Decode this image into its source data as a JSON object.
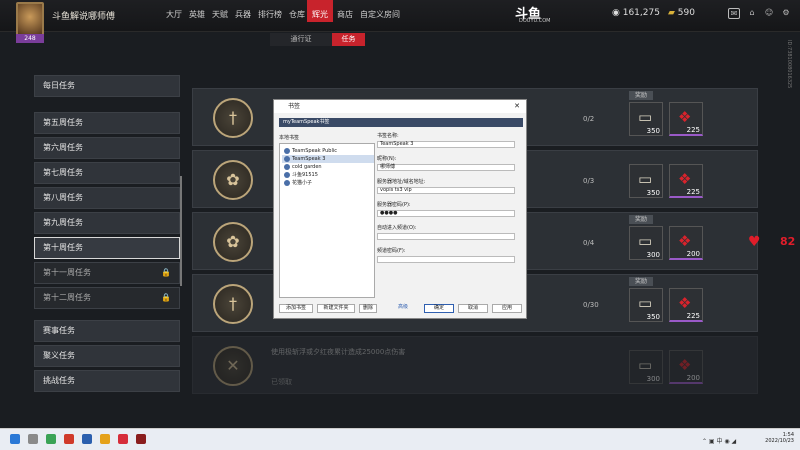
{
  "app": {
    "title": "斗鱼解说哪师傅",
    "level": "248"
  },
  "nav": {
    "items": [
      "大厅",
      "英雄",
      "天赋",
      "兵器",
      "排行榜",
      "仓库",
      "辉光",
      "商店",
      "自定义房间"
    ],
    "active": "辉光"
  },
  "brand": {
    "logo": "斗鱼",
    "sub": "DOUYU.COM"
  },
  "currency": {
    "coins": "161,275",
    "gold": "590"
  },
  "subtabs": {
    "pass": "通行证",
    "task": "任务"
  },
  "sidebar": {
    "items": [
      {
        "label": "每日任务"
      },
      {
        "label": "第五周任务"
      },
      {
        "label": "第六周任务"
      },
      {
        "label": "第七周任务"
      },
      {
        "label": "第八周任务"
      },
      {
        "label": "第九周任务"
      },
      {
        "label": "第十周任务"
      },
      {
        "label": "第十一周任务"
      },
      {
        "label": "第十二周任务"
      },
      {
        "label": "赛事任务"
      },
      {
        "label": "聚义任务"
      },
      {
        "label": "挑战任务"
      }
    ]
  },
  "tasks": [
    {
      "progress": "0/2",
      "scroll": "350",
      "gem": "225",
      "reward": "奖励"
    },
    {
      "progress": "0/3",
      "scroll": "350",
      "gem": "225",
      "reward": "奖励"
    },
    {
      "progress": "0/4",
      "scroll": "300",
      "gem": "200",
      "reward": "奖励"
    },
    {
      "progress": "0/30",
      "scroll": "350",
      "gem": "225",
      "reward": "奖励"
    },
    {
      "text": "使用极斩浮或夕红夜累计造成25000点伤害",
      "sub": "已领取",
      "scroll": "300",
      "gem": "200"
    }
  ],
  "heart": {
    "count": "82"
  },
  "side_id": "ID:7381008016325",
  "dialog": {
    "title": "书签",
    "close": "✕",
    "header": "myTeamSpeak书签",
    "tree_label": "本地书签",
    "tree": [
      "TeamSpeak Public",
      "TeamSpeak 3",
      "cold garden",
      "斗鱼91515",
      "花猫小子"
    ],
    "fields": [
      {
        "label": "书签名称:",
        "value": "TeamSpeak 3"
      },
      {
        "label": "昵称(N):",
        "value": "哪师傅"
      },
      {
        "label": "服务器地址/域名地址:",
        "value": "vopis ts3 vip"
      },
      {
        "label": "服务器密码(P):",
        "value": "●●●●"
      },
      {
        "label": "自动进入频道(O):",
        "value": ""
      },
      {
        "label": "频道密码(F):",
        "value": ""
      }
    ],
    "buttons": {
      "add": "添加书签",
      "folder": "新建文件夹",
      "delete": "删除",
      "advanced": "高级",
      "ok": "确定",
      "cancel": "取消",
      "apply": "应用"
    }
  },
  "clock": {
    "time": "1:54",
    "date": "2022/10/23"
  }
}
